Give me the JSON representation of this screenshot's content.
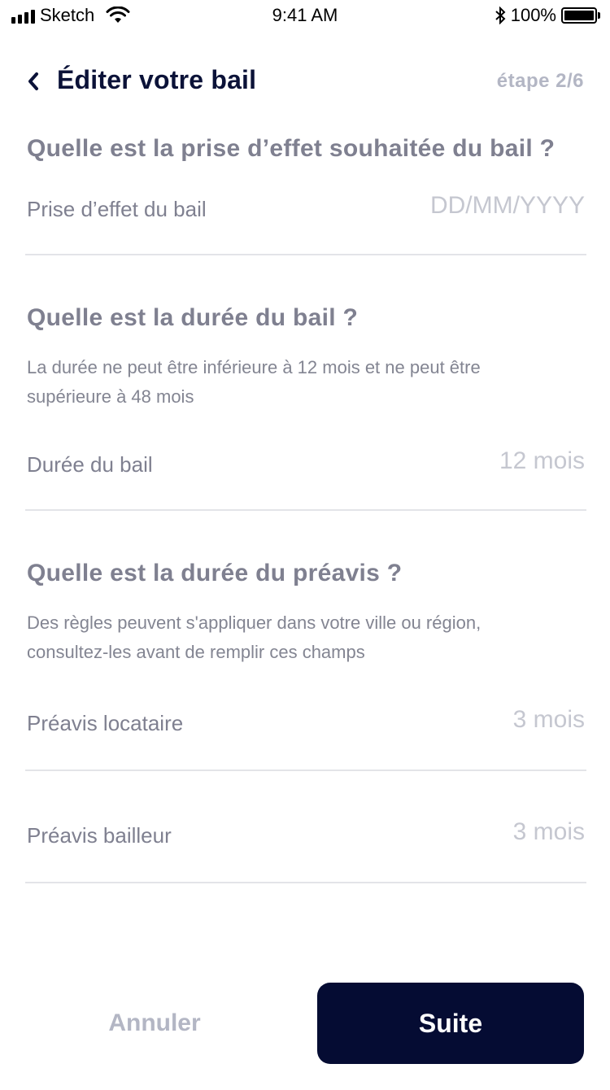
{
  "status_bar": {
    "carrier": "Sketch",
    "time": "9:41 AM",
    "battery": "100%",
    "icons": [
      "signal-icon",
      "wifi-icon",
      "bluetooth-icon",
      "battery-icon"
    ]
  },
  "header": {
    "title": "Éditer votre bail",
    "step": "étape 2/6",
    "back_icon": "chevron-left-icon"
  },
  "section_start": {
    "question": "Quelle est la prise d’effet souhaitée du bail ?",
    "field": {
      "label": "Prise d’effet du bail",
      "placeholder": "DD/MM/YYYY",
      "value": ""
    }
  },
  "section_duration": {
    "question": "Quelle est la durée du bail ?",
    "helper_line1": "La durée ne peut être inférieure à 12 mois et ne peut être",
    "helper_line2": "supérieure à 48 mois",
    "field": {
      "label": "Durée du bail",
      "placeholder": "12 mois",
      "value": ""
    }
  },
  "section_notice": {
    "question": "Quelle est la durée du préavis ?",
    "helper_line1": "Des règles peuvent s'appliquer dans votre ville ou région,",
    "helper_line2": "consultez-les avant de remplir ces champs",
    "tenant_field": {
      "label": "Préavis locataire",
      "placeholder": "3 mois",
      "value": ""
    },
    "landlord_field": {
      "label": "Préavis bailleur",
      "placeholder": "3 mois",
      "value": ""
    }
  },
  "footer": {
    "cancel_label": "Annuler",
    "next_label": "Suite"
  },
  "colors": {
    "primary": "#050c33",
    "title": "#0b1238",
    "muted": "#7f8090",
    "placeholder": "#c5c7d0",
    "divider": "#e3e4e8"
  }
}
